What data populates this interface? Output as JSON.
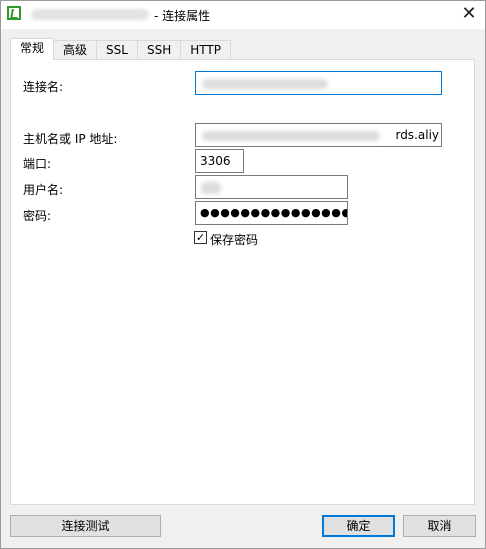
{
  "window": {
    "title": "- 连接属性",
    "close_glyph": "✕"
  },
  "tabs": [
    {
      "label": "常规",
      "active": true
    },
    {
      "label": "高级",
      "active": false
    },
    {
      "label": "SSL",
      "active": false
    },
    {
      "label": "SSH",
      "active": false
    },
    {
      "label": "HTTP",
      "active": false
    }
  ],
  "form": {
    "connection_name": {
      "label": "连接名:",
      "value": ""
    },
    "host": {
      "label": "主机名或 IP 地址:",
      "value": "rds.aliy"
    },
    "port": {
      "label": "端口:",
      "value": "3306"
    },
    "username": {
      "label": "用户名:",
      "value": ""
    },
    "password": {
      "label": "密码:",
      "value": "●●●●●●●●●●●●●●●"
    },
    "save_password": {
      "label": "保存密码",
      "checked": true,
      "check_glyph": "✓"
    }
  },
  "buttons": {
    "test": "连接测试",
    "ok": "确定",
    "cancel": "取消"
  }
}
